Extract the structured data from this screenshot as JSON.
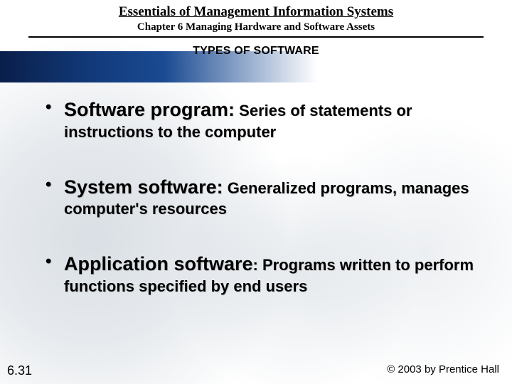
{
  "header": {
    "title": "Essentials of Management Information Systems",
    "chapter": "Chapter 6 Managing Hardware and Software Assets",
    "section": "TYPES OF SOFTWARE"
  },
  "bullets": [
    {
      "term": "Software program:",
      "definition": " Series of statements or instructions to the computer"
    },
    {
      "term": "System software:",
      "definition": " Generalized programs, manages computer's resources"
    },
    {
      "term": "Application software",
      "colon": ":",
      "definition": " Programs written to perform functions specified by end users"
    }
  ],
  "footer": {
    "page": "6.31",
    "copyright": "© 2003 by Prentice Hall"
  }
}
